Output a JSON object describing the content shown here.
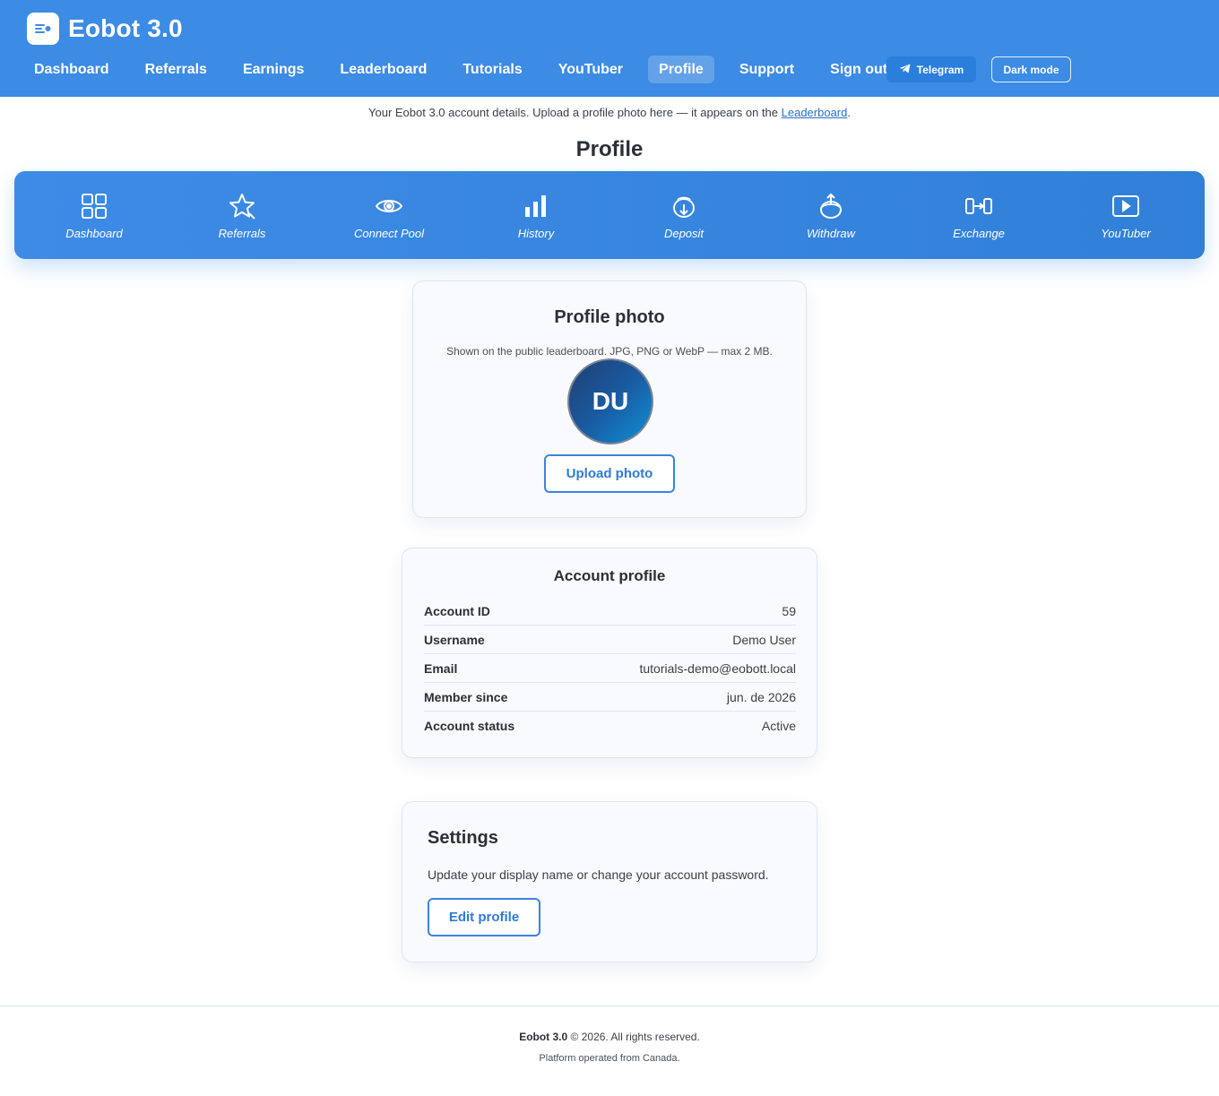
{
  "app": {
    "title": "Eobot 3.0",
    "logo_icon": "menu-dot-icon"
  },
  "nav": {
    "items": [
      {
        "label": "Dashboard"
      },
      {
        "label": "Referrals"
      },
      {
        "label": "Earnings"
      },
      {
        "label": "Leaderboard"
      },
      {
        "label": "Tutorials"
      },
      {
        "label": "YouTuber"
      },
      {
        "label": "Profile",
        "active": true
      },
      {
        "label": "Support"
      },
      {
        "label": "Sign out"
      }
    ],
    "telegram_label": "Telegram",
    "dark_mode_label": "Dark mode"
  },
  "intro": {
    "text": "Your Eobot 3.0 account details. Upload a profile photo here — it appears on the",
    "link": "Leaderboard",
    "end": "."
  },
  "page_title": "Profile",
  "quick_links": [
    {
      "label": "Dashboard",
      "icon": "grid-icon"
    },
    {
      "label": "Referrals",
      "icon": "star-icon"
    },
    {
      "label": "Connect Pool",
      "icon": "eye-icon"
    },
    {
      "label": "History",
      "icon": "bar-chart-icon"
    },
    {
      "label": "Deposit",
      "icon": "deposit-icon"
    },
    {
      "label": "Withdraw",
      "icon": "withdraw-icon"
    },
    {
      "label": "Exchange",
      "icon": "exchange-icon"
    },
    {
      "label": "YouTuber",
      "icon": "play-icon"
    }
  ],
  "photo_card": {
    "title": "Profile photo",
    "hint": "Shown on the public leaderboard. JPG, PNG or WebP — max 2 MB.",
    "avatar_initials": "DU",
    "upload_label": "Upload photo"
  },
  "account_card": {
    "title": "Account profile",
    "rows": [
      {
        "label": "Account ID",
        "value": "59"
      },
      {
        "label": "Username",
        "value": "Demo User"
      },
      {
        "label": "Email",
        "value": "tutorials-demo@eobott.local"
      },
      {
        "label": "Member since",
        "value": "jun. de 2026"
      },
      {
        "label": "Account status",
        "value": "Active"
      }
    ]
  },
  "settings_card": {
    "title": "Settings",
    "description": "Update your display name or change your account password.",
    "edit_label": "Edit profile"
  },
  "footer": {
    "brand": "Eobot 3.0",
    "copyright": "© 2026. All rights reserved.",
    "note": "Platform operated from Canada."
  },
  "colors": {
    "header": "#3c8be4",
    "accent": "#3a84dc",
    "text": "#2b2f36"
  }
}
